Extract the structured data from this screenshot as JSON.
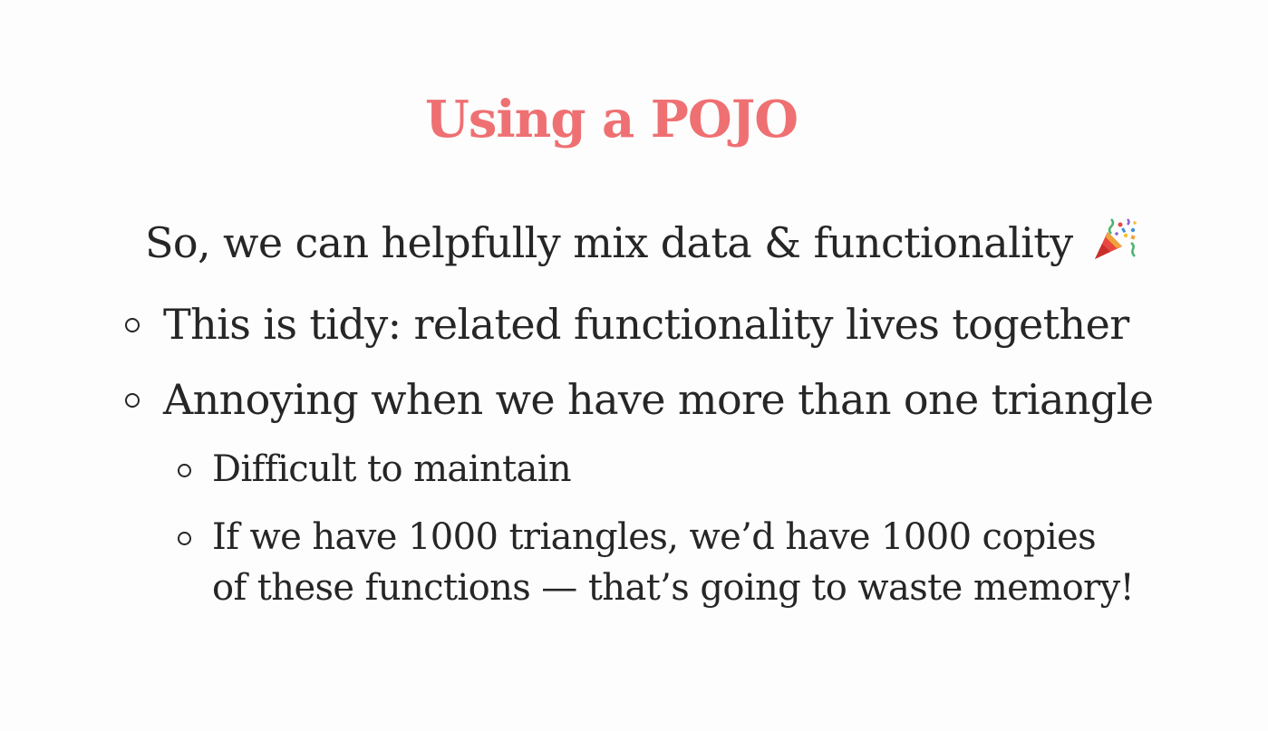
{
  "slide": {
    "title": "Using a POJO",
    "title_color": "#ef7072",
    "intro": "So, we can helpfully mix data & functionality",
    "intro_icon": "party-popper-icon",
    "bullets": [
      {
        "text": "This is tidy: related functionality lives together"
      },
      {
        "text": "Annoying when we have more than one triangle"
      }
    ],
    "sub_bullets": [
      {
        "text": "Difficult to maintain"
      },
      {
        "line1": "If we have 1000 triangles, we’d have 1000 copies",
        "line2": "of these functions — that’s going to waste memory!"
      }
    ]
  }
}
